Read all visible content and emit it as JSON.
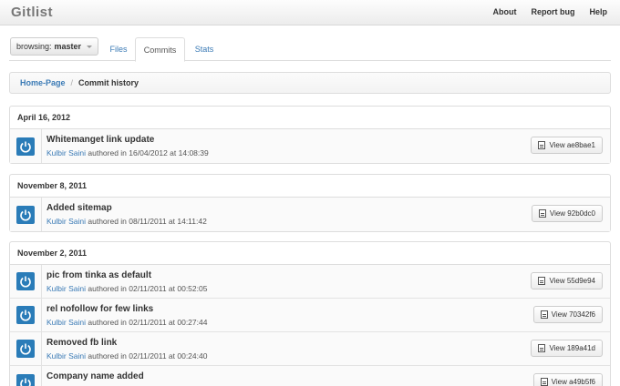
{
  "navbar": {
    "brand": "Gitlist",
    "links": [
      "About",
      "Report bug",
      "Help"
    ]
  },
  "branch": {
    "prefix": "browsing:",
    "name": "master"
  },
  "tabs": [
    "Files",
    "Commits",
    "Stats"
  ],
  "active_tab": "Commits",
  "breadcrumb": {
    "home": "Home-Page",
    "separator": "/",
    "current": "Commit history"
  },
  "groups": [
    {
      "date": "April 16, 2012",
      "commits": [
        {
          "message": "Whitemanget link update",
          "author": "Kulbir Saini",
          "authored": "authored in 16/04/2012 at 14:08:39",
          "view": "View ae8bae1"
        }
      ]
    },
    {
      "date": "November 8, 2011",
      "commits": [
        {
          "message": "Added sitemap",
          "author": "Kulbir Saini",
          "authored": "authored in 08/11/2011 at 14:11:42",
          "view": "View 92b0dc0"
        }
      ]
    },
    {
      "date": "November 2, 2011",
      "commits": [
        {
          "message": "pic from tinka as default",
          "author": "Kulbir Saini",
          "authored": "authored in 02/11/2011 at 00:52:05",
          "view": "View 55d9e94"
        },
        {
          "message": "rel nofollow for few links",
          "author": "Kulbir Saini",
          "authored": "authored in 02/11/2011 at 00:27:44",
          "view": "View 70342f6"
        },
        {
          "message": "Removed fb link",
          "author": "Kulbir Saini",
          "authored": "authored in 02/11/2011 at 00:24:40",
          "view": "View 189a41d"
        },
        {
          "message": "Company name added",
          "author": "",
          "authored": "",
          "view": "View a49b5f6"
        }
      ]
    }
  ],
  "colors": {
    "accent": "#3a7ab5",
    "avatar": "#2a7cb8"
  }
}
